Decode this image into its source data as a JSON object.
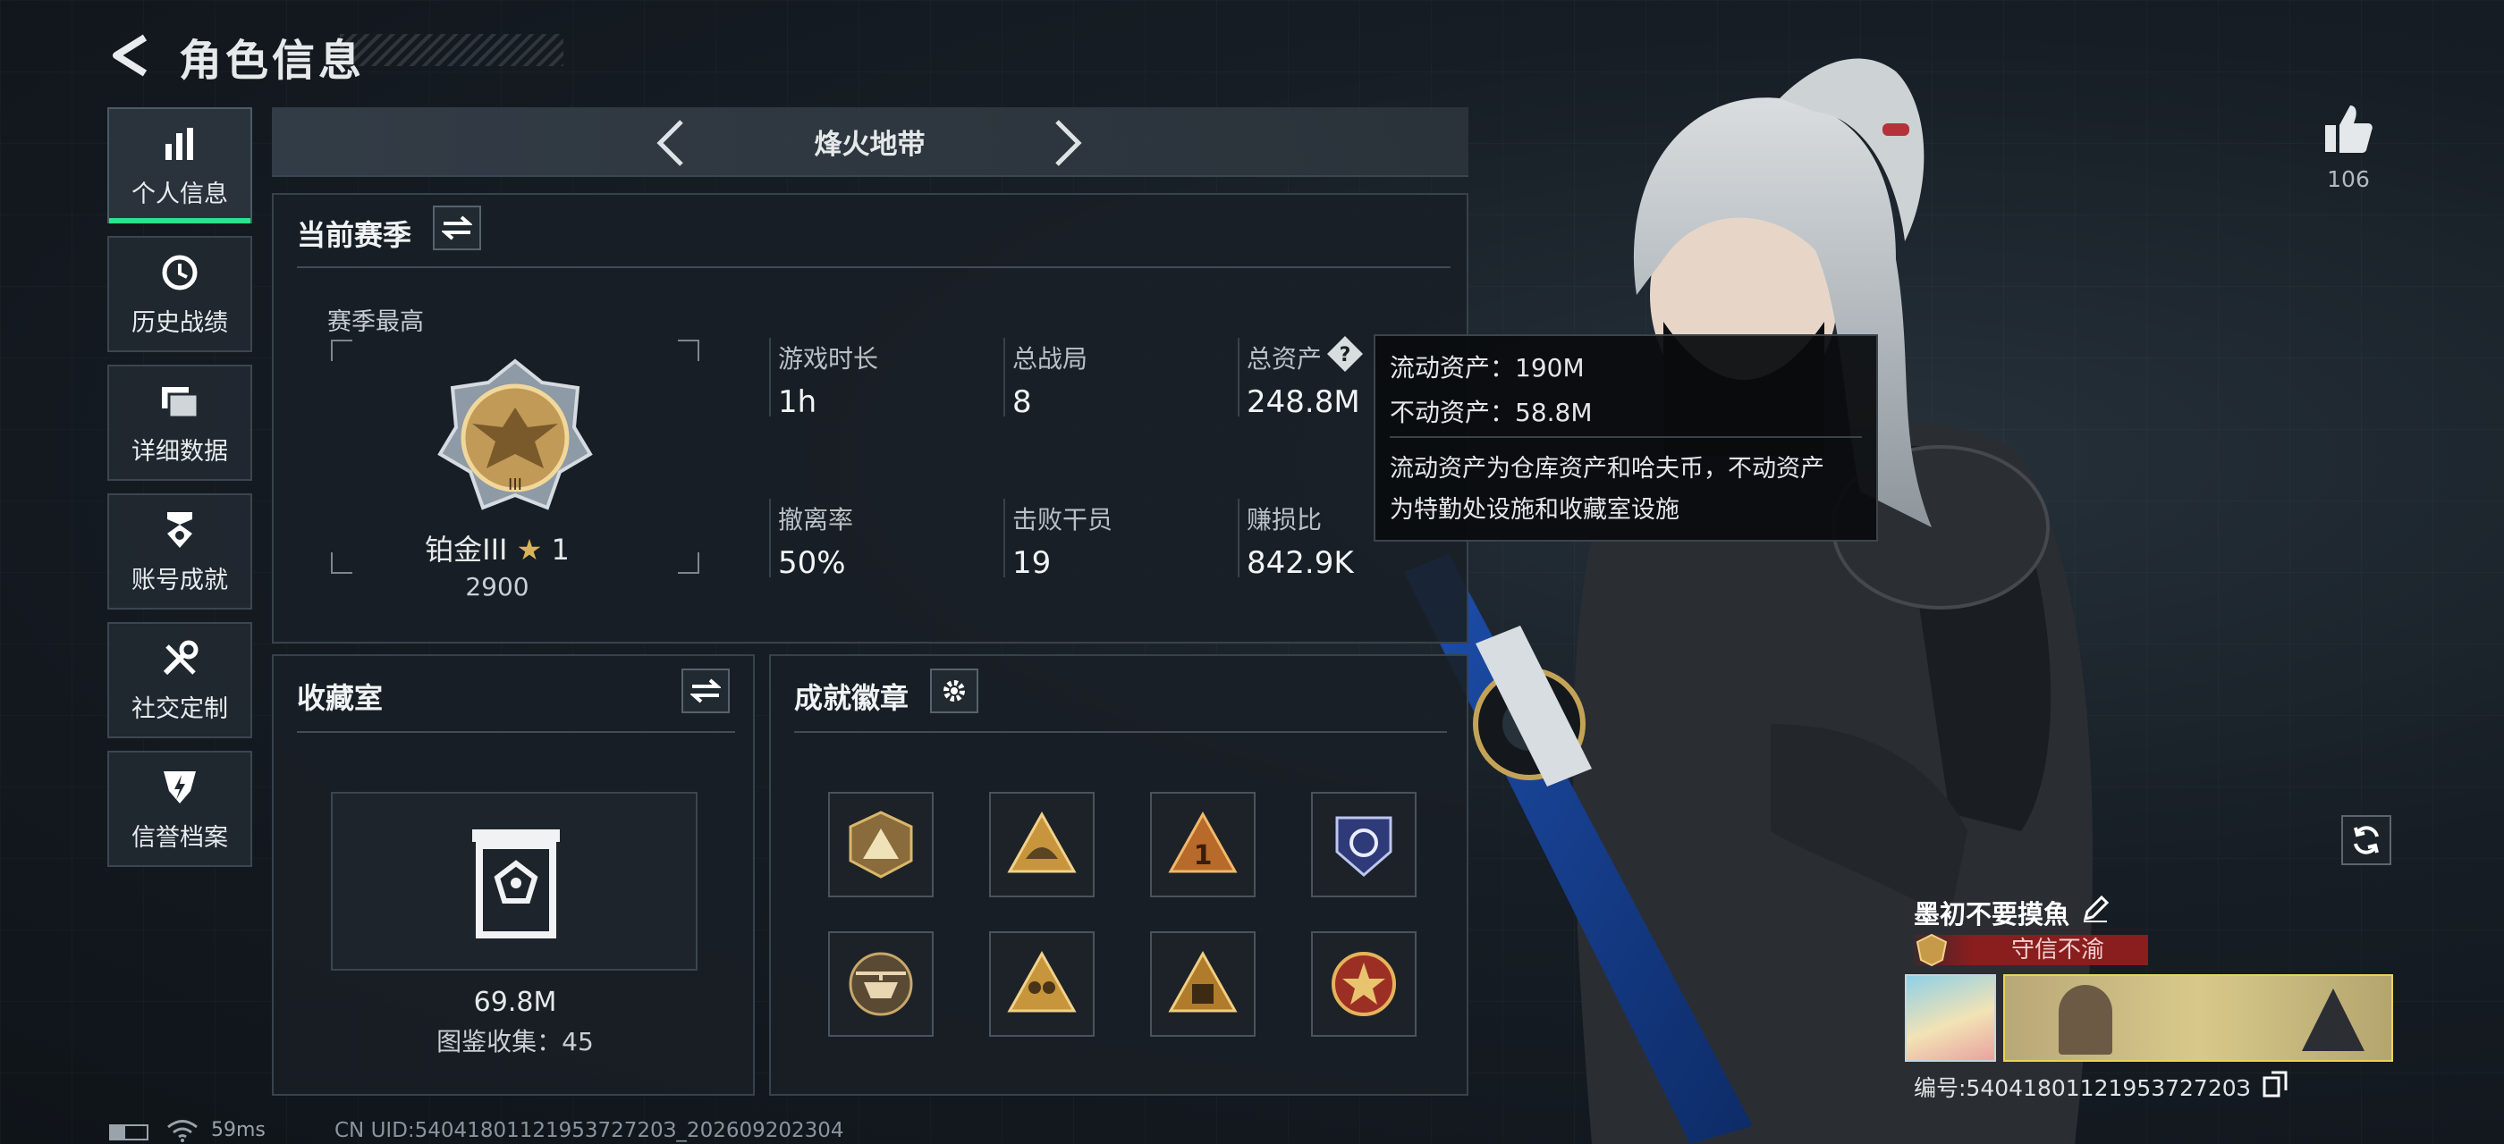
{
  "header": {
    "title": "角色信息"
  },
  "nav": {
    "items": [
      {
        "label": "个人信息",
        "icon": "bar-chart-icon",
        "active": true
      },
      {
        "label": "历史战绩",
        "icon": "clock-history-icon"
      },
      {
        "label": "详细数据",
        "icon": "folders-icon"
      },
      {
        "label": "账号成就",
        "icon": "achievement-medal-icon"
      },
      {
        "label": "社交定制",
        "icon": "tools-icon"
      },
      {
        "label": "信誉档案",
        "icon": "reputation-shield-icon"
      }
    ]
  },
  "mode": {
    "name": "烽火地带"
  },
  "season": {
    "title": "当前赛季",
    "best_label": "赛季最高",
    "rank_name": "铂金III",
    "rank_stars": "1",
    "rank_points": "2900",
    "stats": [
      {
        "label": "游戏时长",
        "value": "1h"
      },
      {
        "label": "总战局",
        "value": "8"
      },
      {
        "label": "总资产",
        "value": "248.8M"
      },
      {
        "label": "撤离率",
        "value": "50%"
      },
      {
        "label": "击败干员",
        "value": "19"
      },
      {
        "label": "赚损比",
        "value": "842.9K"
      }
    ]
  },
  "tooltip": {
    "line1": "流动资产：190M",
    "line2": "不动资产：58.8M",
    "desc1": "流动资产为仓库资产和哈夫币，不动资产",
    "desc2": "为特勤处设施和收藏室设施"
  },
  "collection": {
    "title": "收藏室",
    "value": "69.8M",
    "count_text": "图鉴收集：45"
  },
  "badges": {
    "title": "成就徽章",
    "items": [
      "badge-1",
      "badge-2",
      "badge-3",
      "badge-4",
      "badge-5",
      "badge-6",
      "badge-7",
      "badge-8"
    ]
  },
  "likes": {
    "count": "106"
  },
  "player": {
    "name": "墨初不要摸魚",
    "reputation": "守信不渝",
    "id_text": "编号:5404180112195372720З"
  },
  "footer": {
    "ping": "59ms",
    "uid": "CN UID:5404180112195372720З_202609202304"
  },
  "colors": {
    "accent": "#2fe08c",
    "reputation": "#8a1d1d",
    "gold": "#c9a45a"
  }
}
